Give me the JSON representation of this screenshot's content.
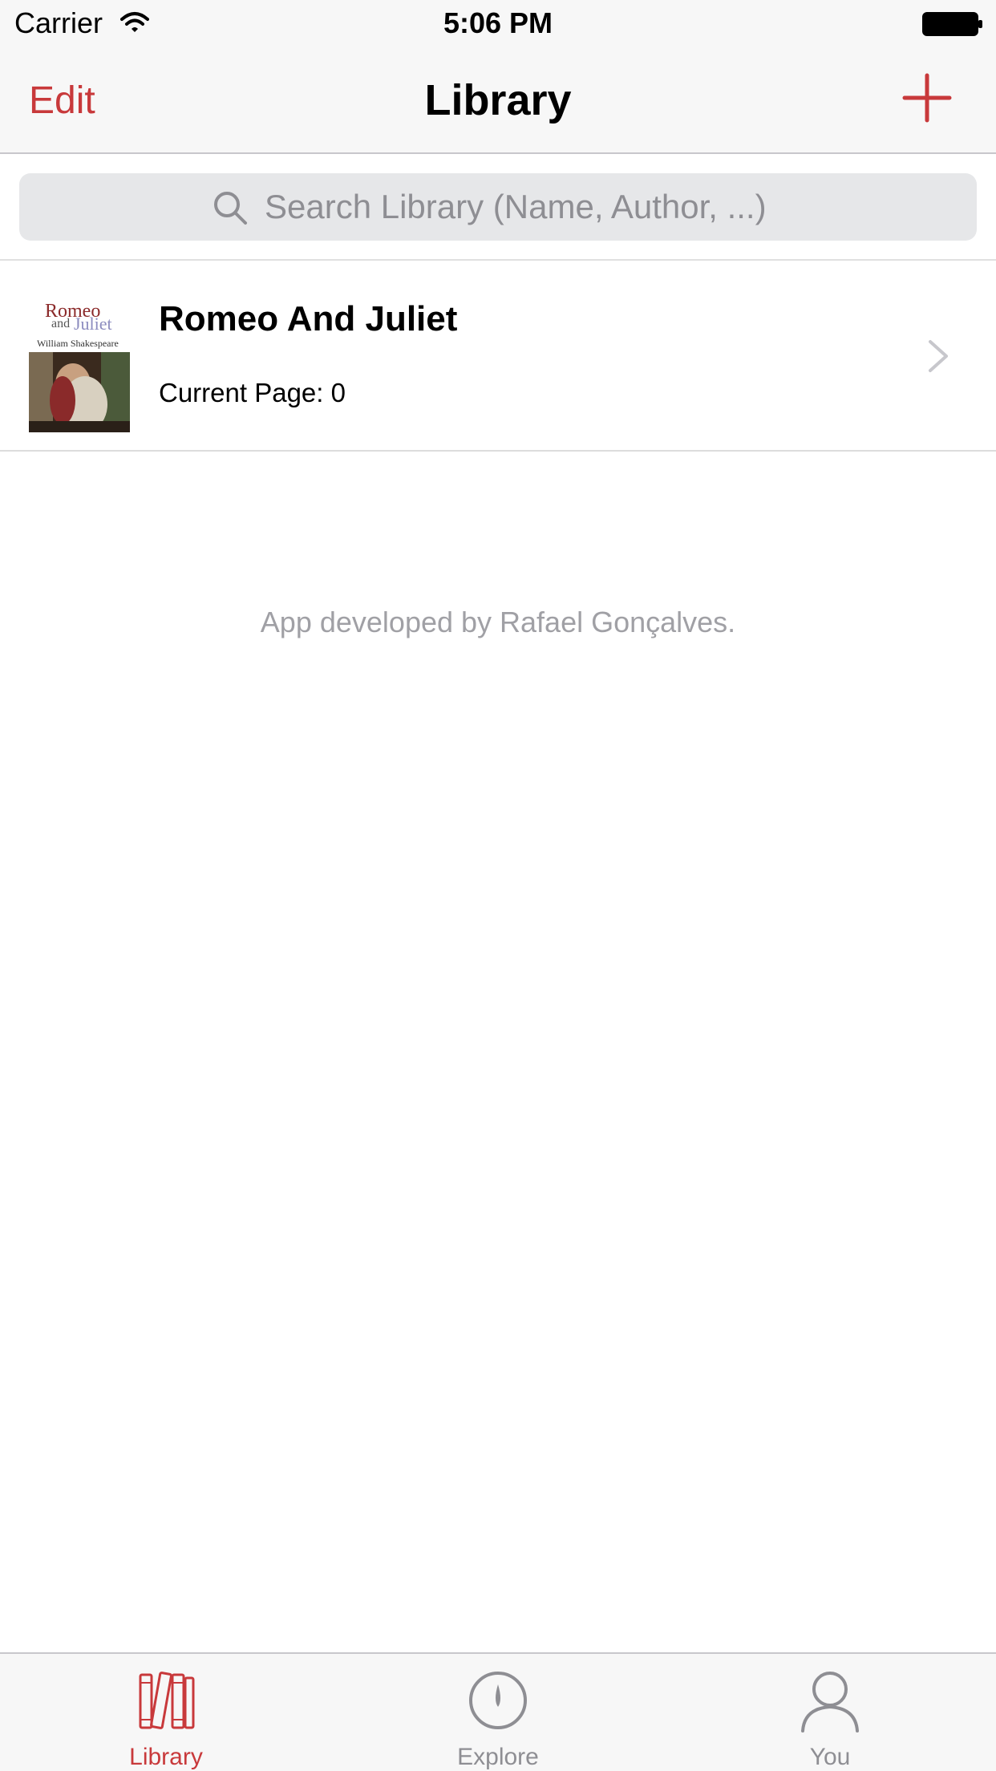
{
  "status_bar": {
    "carrier": "Carrier",
    "time": "5:06 PM"
  },
  "nav": {
    "edit_label": "Edit",
    "title": "Library",
    "add_icon": "plus-icon"
  },
  "search": {
    "placeholder": "Search Library (Name, Author, ...)"
  },
  "books": [
    {
      "title": "Romeo And Juliet",
      "current_page": "Current Page: 0",
      "cover": {
        "title_line1": "Romeo",
        "title_and": "and",
        "title_line2": "Juliet",
        "author": "William Shakespeare"
      }
    }
  ],
  "footer": {
    "credit": "App developed by Rafael Gonçalves."
  },
  "tabs": [
    {
      "label": "Library",
      "icon": "books-icon",
      "active": true
    },
    {
      "label": "Explore",
      "icon": "compass-icon",
      "active": false
    },
    {
      "label": "You",
      "icon": "person-icon",
      "active": false
    }
  ],
  "colors": {
    "accent": "#c8393b",
    "inactive": "#8e8e93",
    "bar_background": "#f7f7f7"
  }
}
